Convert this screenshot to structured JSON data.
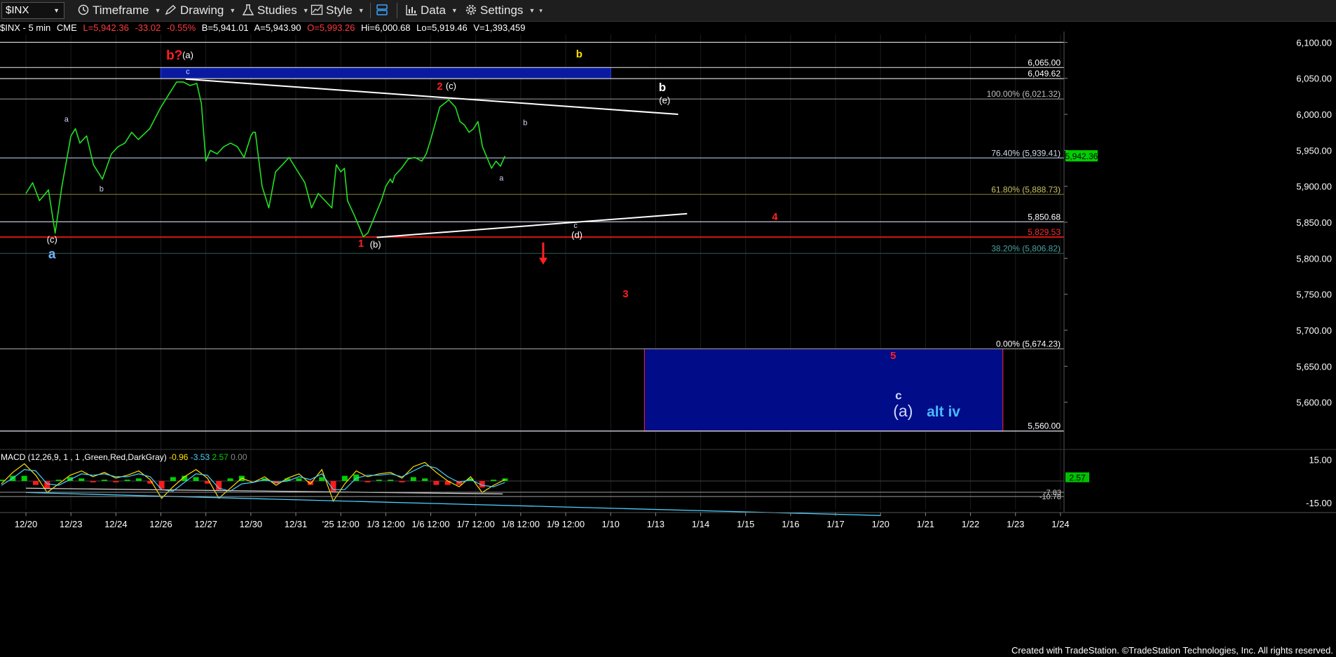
{
  "toolbar": {
    "symbol": "$INX",
    "timeframe": "Timeframe",
    "drawing": "Drawing",
    "studies": "Studies",
    "style": "Style",
    "data": "Data",
    "settings": "Settings"
  },
  "infobar": {
    "symbol": "$INX - 5 min",
    "exchange": "CME",
    "last": "L=5,942.36",
    "change": "-33.02",
    "change_pct": "-0.55%",
    "bid": "B=5,941.01",
    "ask": "A=5,943.90",
    "open": "O=5,993.26",
    "high": "Hi=6,000.68",
    "low": "Lo=5,919.46",
    "volume": "V=1,393,459",
    "colors": {
      "neutral": "#ffffff",
      "negative": "#ff3b3b"
    }
  },
  "footer": "Created with TradeStation. ©TradeStation Technologies, Inc. All rights reserved.",
  "chart_data": {
    "type": "line",
    "symbol": "$INX",
    "interval": "5 min",
    "ylim": [
      5550,
      6115
    ],
    "x_ticks": [
      "12/20",
      "12/23",
      "12/24",
      "12/26",
      "12/27",
      "12/30",
      "12/31",
      "'25 12:00",
      "1/3 12:00",
      "1/6 12:00",
      "1/7 12:00",
      "1/8 12:00",
      "1/9 12:00",
      "1/10",
      "1/13",
      "1/14",
      "1/15",
      "1/16",
      "1/17",
      "1/20",
      "1/21",
      "1/22",
      "1/23",
      "1/24"
    ],
    "y_ticks": [
      6100,
      6050,
      6000,
      5950,
      5900,
      5850,
      5800,
      5750,
      5700,
      5650,
      5600
    ],
    "y_tick_labels": [
      "6,100.00",
      "6,050.00",
      "6,000.00",
      "5,950.00",
      "5,900.00",
      "5,850.00",
      "5,800.00",
      "5,750.00",
      "5,700.00",
      "5,650.00",
      "5,600.00"
    ],
    "last_price": {
      "value": 5942.36,
      "label": "5,942.36",
      "color": "#00d000"
    },
    "price_series": {
      "x": [
        0,
        0.15,
        0.3,
        0.5,
        0.65,
        0.8,
        1.0,
        1.1,
        1.2,
        1.35,
        1.5,
        1.7,
        1.9,
        2.05,
        2.2,
        2.35,
        2.5,
        2.75,
        3.0,
        3.2,
        3.35,
        3.5,
        3.65,
        3.8,
        3.9,
        4.0,
        4.1,
        4.25,
        4.4,
        4.55,
        4.7,
        4.85,
        5.0,
        5.05,
        5.1,
        5.25,
        5.4,
        5.55,
        5.7,
        5.85,
        6.0,
        6.2,
        6.35,
        6.5,
        6.65,
        6.8,
        6.9,
        7.0,
        7.08,
        7.15,
        7.3,
        7.5,
        7.6,
        7.7,
        7.8,
        7.9,
        8.0,
        8.1,
        8.15,
        8.2,
        8.35,
        8.5,
        8.65,
        8.8,
        8.9,
        9.0,
        9.2,
        9.4,
        9.55,
        9.65,
        9.75,
        9.85,
        9.95,
        10.05,
        10.15,
        10.25,
        10.35,
        10.45,
        10.55,
        10.65
      ],
      "y": [
        5890,
        5905,
        5880,
        5895,
        5835,
        5900,
        5970,
        5980,
        5960,
        5970,
        5930,
        5910,
        5945,
        5955,
        5960,
        5975,
        5965,
        5980,
        6010,
        6030,
        6045,
        6045,
        6040,
        6043,
        6015,
        5935,
        5950,
        5945,
        5955,
        5960,
        5955,
        5940,
        5970,
        5975,
        5975,
        5900,
        5870,
        5920,
        5930,
        5940,
        5925,
        5905,
        5870,
        5890,
        5880,
        5870,
        5930,
        5920,
        5925,
        5880,
        5860,
        5830,
        5835,
        5850,
        5865,
        5880,
        5900,
        5910,
        5905,
        5915,
        5925,
        5938,
        5940,
        5935,
        5945,
        5965,
        6010,
        6020,
        6010,
        5990,
        5985,
        5975,
        5980,
        5990,
        5955,
        5940,
        5925,
        5935,
        5928,
        5942
      ]
    },
    "horizontal_levels": [
      {
        "value": 6100,
        "label": "",
        "color": "#cfcfcf",
        "label_color": "#cfcfcf",
        "side": "right"
      },
      {
        "value": 6065,
        "label": "6,065.00",
        "color": "#cfcfcf",
        "label_color": "#ffffff",
        "side": "right"
      },
      {
        "value": 6049.62,
        "label": "6,049.62",
        "color": "#cfcfcf",
        "label_color": "#ffffff",
        "side": "right"
      },
      {
        "value": 6021.32,
        "label": "100.00% (6,021.32)",
        "color": "#8e8e8e",
        "label_color": "#bfbfbf",
        "side": "right"
      },
      {
        "value": 5939.41,
        "label": "76.40% (5,939.41)",
        "color": "#9fb0c8",
        "label_color": "#cfd7e6",
        "side": "right"
      },
      {
        "value": 5888.73,
        "label": "61.80% (5,888.73)",
        "color": "#6e6a2a",
        "label_color": "#c7c160",
        "side": "right"
      },
      {
        "value": 5850.68,
        "label": "5,850.68",
        "color": "#d9dde8",
        "label_color": "#ffffff",
        "side": "right"
      },
      {
        "value": 5829.53,
        "label": "5,829.53",
        "color": "#ff1a1a",
        "label_color": "#ff2a2a",
        "side": "right"
      },
      {
        "value": 5806.82,
        "label": "38.20% (5,806.82)",
        "color": "#1f4a4a",
        "label_color": "#4aa0a0",
        "side": "right"
      },
      {
        "value": 5674.23,
        "label": "0.00% (5,674.23)",
        "color": "#8e8e8e",
        "label_color": "#ffffff",
        "side": "right"
      },
      {
        "value": 5560.0,
        "label": "5,560.00",
        "color": "#e6e6f0",
        "label_color": "#ffffff",
        "side": "right"
      }
    ],
    "zones": [
      {
        "x0": 3.0,
        "x1": 13.0,
        "y0": 6049.62,
        "y1": 6065,
        "fill": "#0a1aa0",
        "stroke": "#2e40ff"
      },
      {
        "x0": 13.75,
        "x1": 21.72,
        "y0": 5560,
        "y1": 5674.23,
        "fill": "#000c88",
        "stroke": "#ff2a2a"
      }
    ],
    "trendlines": [
      {
        "x0": 3.55,
        "y0": 6049,
        "x1": 14.5,
        "y1": 6000,
        "color": "#ffffff"
      },
      {
        "x0": 7.8,
        "y0": 5829,
        "x1": 14.7,
        "y1": 5862,
        "color": "#ffffff"
      }
    ],
    "annotations": [
      {
        "text": "b?",
        "x": 3.3,
        "y": 6076,
        "color": "#ff2020",
        "size": 19,
        "bold": true
      },
      {
        "text": "(a)",
        "x": 3.6,
        "y": 6078,
        "color": "#ffffff",
        "size": 13,
        "bold": false
      },
      {
        "text": "c",
        "x": 3.6,
        "y": 6056,
        "color": "#cfd8ff",
        "size": 11,
        "bold": false
      },
      {
        "text": "b",
        "x": 12.3,
        "y": 6079,
        "color": "#ffe000",
        "size": 15,
        "bold": true
      },
      {
        "text": "2",
        "x": 9.2,
        "y": 6034,
        "color": "#ff2020",
        "size": 15,
        "bold": true
      },
      {
        "text": "(c)",
        "x": 9.45,
        "y": 6035,
        "color": "#ffffff",
        "size": 13,
        "bold": false
      },
      {
        "text": "b",
        "x": 14.15,
        "y": 6032,
        "color": "#ffffff",
        "size": 17,
        "bold": true
      },
      {
        "text": "(e)",
        "x": 14.2,
        "y": 6015,
        "color": "#ffffff",
        "size": 13,
        "bold": false
      },
      {
        "text": "b",
        "x": 11.1,
        "y": 5985,
        "color": "#cfd8ff",
        "size": 11,
        "bold": false
      },
      {
        "text": "a",
        "x": 0.9,
        "y": 5990,
        "color": "#cfd8ff",
        "size": 11,
        "bold": false
      },
      {
        "text": "b",
        "x": 1.68,
        "y": 5893,
        "color": "#cfd8ff",
        "size": 11,
        "bold": false
      },
      {
        "text": "a",
        "x": 10.57,
        "y": 5908,
        "color": "#cfd8ff",
        "size": 11,
        "bold": false
      },
      {
        "text": "4",
        "x": 16.65,
        "y": 5853,
        "color": "#ff2020",
        "size": 15,
        "bold": true
      },
      {
        "text": "c",
        "x": 12.22,
        "y": 5842,
        "color": "#cfd8ff",
        "size": 11,
        "bold": false
      },
      {
        "text": "(d)",
        "x": 12.25,
        "y": 5828,
        "color": "#ffffff",
        "size": 13,
        "bold": false
      },
      {
        "text": "(c)",
        "x": 0.58,
        "y": 5822,
        "color": "#ffffff",
        "size": 13,
        "bold": false
      },
      {
        "text": "a",
        "x": 0.58,
        "y": 5800,
        "color": "#6fb6ff",
        "size": 19,
        "bold": true
      },
      {
        "text": "1",
        "x": 7.45,
        "y": 5816,
        "color": "#ff2020",
        "size": 15,
        "bold": true
      },
      {
        "text": "(b)",
        "x": 7.77,
        "y": 5815,
        "color": "#ffffff",
        "size": 13,
        "bold": false
      },
      {
        "text": "3",
        "x": 13.33,
        "y": 5746,
        "color": "#ff2020",
        "size": 15,
        "bold": true
      },
      {
        "text": "5",
        "x": 19.28,
        "y": 5660,
        "color": "#ff2020",
        "size": 15,
        "bold": true
      },
      {
        "text": "c",
        "x": 19.4,
        "y": 5604,
        "color": "#cfd8ff",
        "size": 17,
        "bold": true
      },
      {
        "text": "(a)",
        "x": 19.5,
        "y": 5580,
        "color": "#cfd8ff",
        "size": 23,
        "bold": false
      },
      {
        "text": "alt iv",
        "x": 20.4,
        "y": 5580,
        "color": "#4ab8ff",
        "size": 21,
        "bold": true
      }
    ],
    "arrow": {
      "x": 11.5,
      "y_from": 5822,
      "y_to": 5793,
      "color": "#ff2020"
    },
    "macd": {
      "label": "MACD (12,26,9, 1 , 1 ,Green,Red,DarkGray)",
      "values": {
        "macd": "-0.96",
        "signal": "-3.53",
        "hist": "2.57",
        "zero": "0.00"
      },
      "colors": {
        "macd": "#ffe000",
        "signal": "#4ad0ff",
        "hist_pos": "#00d000",
        "hist_neg": "#ff1a1a"
      },
      "ylim": [
        -20,
        20
      ],
      "y_ticks": [
        15,
        -15
      ],
      "y_tick_labels": [
        "15.00",
        "-15.00"
      ],
      "levels": [
        {
          "value": 2.57,
          "label": "2.57",
          "color": "#00c000"
        },
        {
          "value": -7.83,
          "label": "-7.83",
          "color": "#cfcfcf"
        },
        {
          "value": -10.78,
          "label": "-10.78",
          "color": "#cfcfcf"
        }
      ],
      "series_macd": [
        -2,
        6,
        12,
        4,
        -8,
        -2,
        4,
        7,
        3,
        6,
        2,
        4,
        7,
        1,
        -12,
        -4,
        3,
        8,
        2,
        -12,
        -5,
        2,
        -1,
        3,
        -3,
        2,
        5,
        -2,
        8,
        -14,
        -2,
        7,
        3,
        5,
        6,
        2,
        10,
        13,
        6,
        0,
        -4,
        3,
        -8,
        -3,
        1
      ],
      "series_signal": [
        -3,
        2,
        8,
        7,
        -2,
        -3,
        1,
        5,
        4,
        5,
        3,
        3,
        5,
        3,
        -6,
        -7,
        -1,
        5,
        4,
        -5,
        -7,
        -2,
        -1,
        1,
        -1,
        0,
        3,
        1,
        5,
        -6,
        -6,
        2,
        4,
        4,
        5,
        3,
        7,
        11,
        9,
        3,
        -1,
        1,
        -3,
        -4,
        -1
      ],
      "trend_lines": [
        {
          "x0": 0,
          "y0": -8,
          "x1": 19,
          "y1": -24,
          "color": "#4ad0ff"
        },
        {
          "x0": 0,
          "y0": -5,
          "x1": 10.6,
          "y1": -9,
          "color": "#cfcfcf"
        }
      ]
    }
  }
}
